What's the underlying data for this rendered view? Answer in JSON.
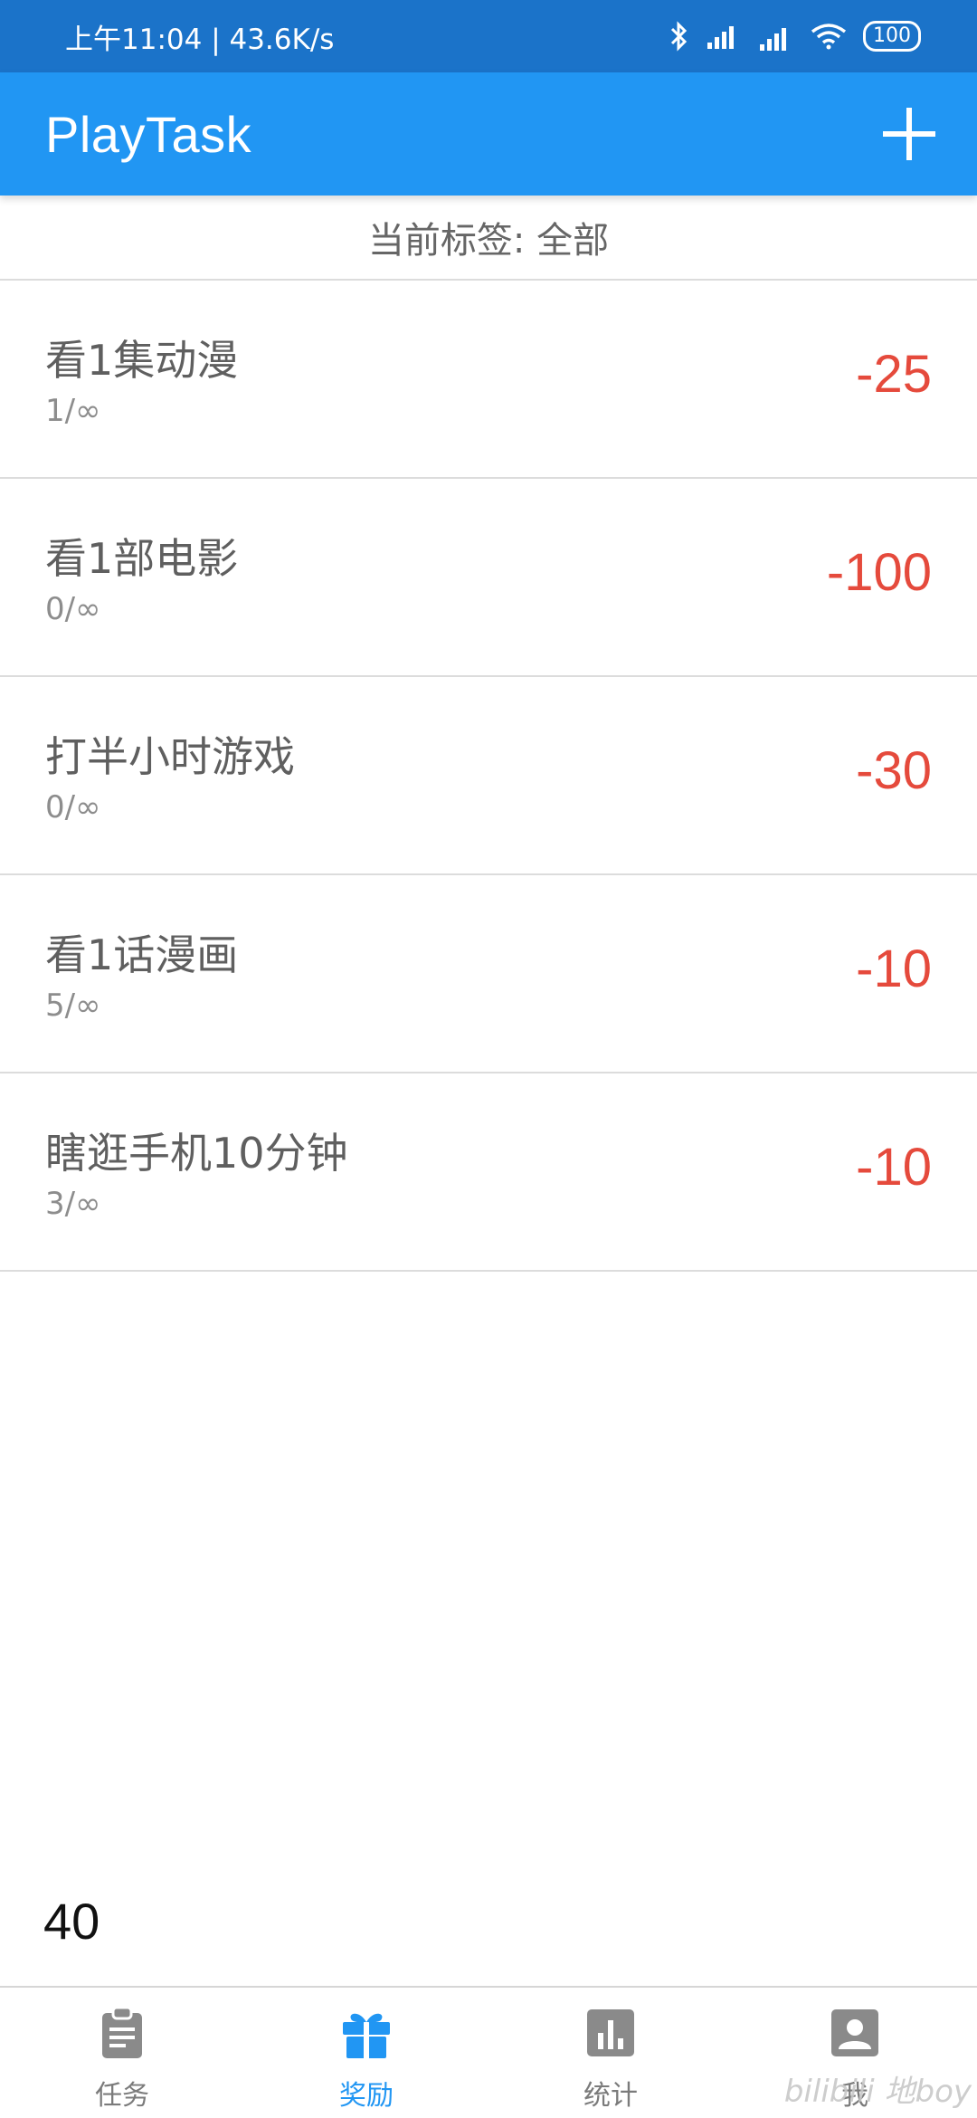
{
  "status_bar": {
    "time_speed": "上午11:04 | 43.6K/s",
    "battery": "100"
  },
  "app_bar": {
    "title": "PlayTask"
  },
  "tag_filter": {
    "label": "当前标签: 全部"
  },
  "rewards": [
    {
      "name": "看1集动漫",
      "progress": "1/∞",
      "cost": "-25"
    },
    {
      "name": "看1部电影",
      "progress": "0/∞",
      "cost": "-100"
    },
    {
      "name": "打半小时游戏",
      "progress": "0/∞",
      "cost": "-30"
    },
    {
      "name": "看1话漫画",
      "progress": "5/∞",
      "cost": "-10"
    },
    {
      "name": "瞎逛手机10分钟",
      "progress": "3/∞",
      "cost": "-10"
    }
  ],
  "points_total": "40",
  "bottom_nav": {
    "items": [
      {
        "label": "任务",
        "icon": "clipboard-icon",
        "active": false
      },
      {
        "label": "奖励",
        "icon": "gift-icon",
        "active": true
      },
      {
        "label": "统计",
        "icon": "bar-chart-icon",
        "active": false
      },
      {
        "label": "我",
        "icon": "account-icon",
        "active": false
      }
    ]
  },
  "watermark": "bilibili 地boy",
  "colors": {
    "status_bar": "#1b73c9",
    "app_bar": "#2196f3",
    "cost": "#e54a3c",
    "nav_active": "#2196f3",
    "nav_inactive": "#7b7b7b"
  }
}
